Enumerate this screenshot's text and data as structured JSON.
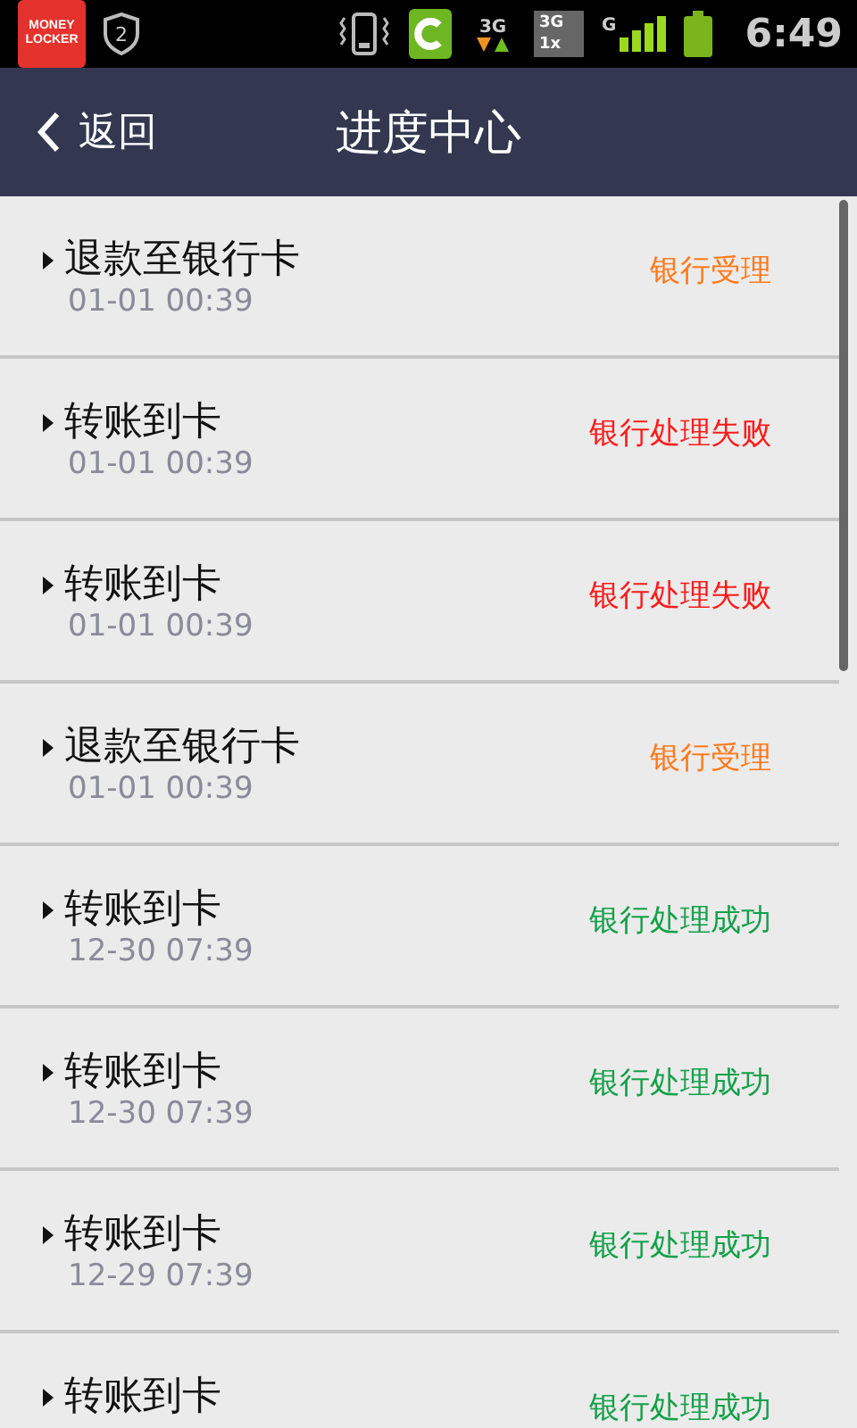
{
  "status_bar": {
    "app_badge": "MONEY\nLOCKER",
    "shield_number": "2",
    "network_3g": "3G",
    "dual_3g": "3G",
    "dual_1x": "1x",
    "signal_g": "G",
    "time": "6:49"
  },
  "header": {
    "back": "返回",
    "title": "进度中心"
  },
  "records": [
    {
      "title": "退款至银行卡",
      "time": "01-01 00:39",
      "status": "银行受理",
      "color": "#ff7a1a"
    },
    {
      "title": "转账到卡",
      "time": "01-01 00:39",
      "status": "银行处理失败",
      "color": "#ff1a1a"
    },
    {
      "title": "转账到卡",
      "time": "01-01 00:39",
      "status": "银行处理失败",
      "color": "#ff1a1a"
    },
    {
      "title": "退款至银行卡",
      "time": "01-01 00:39",
      "status": "银行受理",
      "color": "#ff7a1a"
    },
    {
      "title": "转账到卡",
      "time": "12-30 07:39",
      "status": "银行处理成功",
      "color": "#13a048"
    },
    {
      "title": "转账到卡",
      "time": "12-30 07:39",
      "status": "银行处理成功",
      "color": "#13a048"
    },
    {
      "title": "转账到卡",
      "time": "12-29 07:39",
      "status": "银行处理成功",
      "color": "#13a048"
    },
    {
      "title": "转账到卡",
      "status": "银行处理成功",
      "color": "#13a048"
    }
  ]
}
